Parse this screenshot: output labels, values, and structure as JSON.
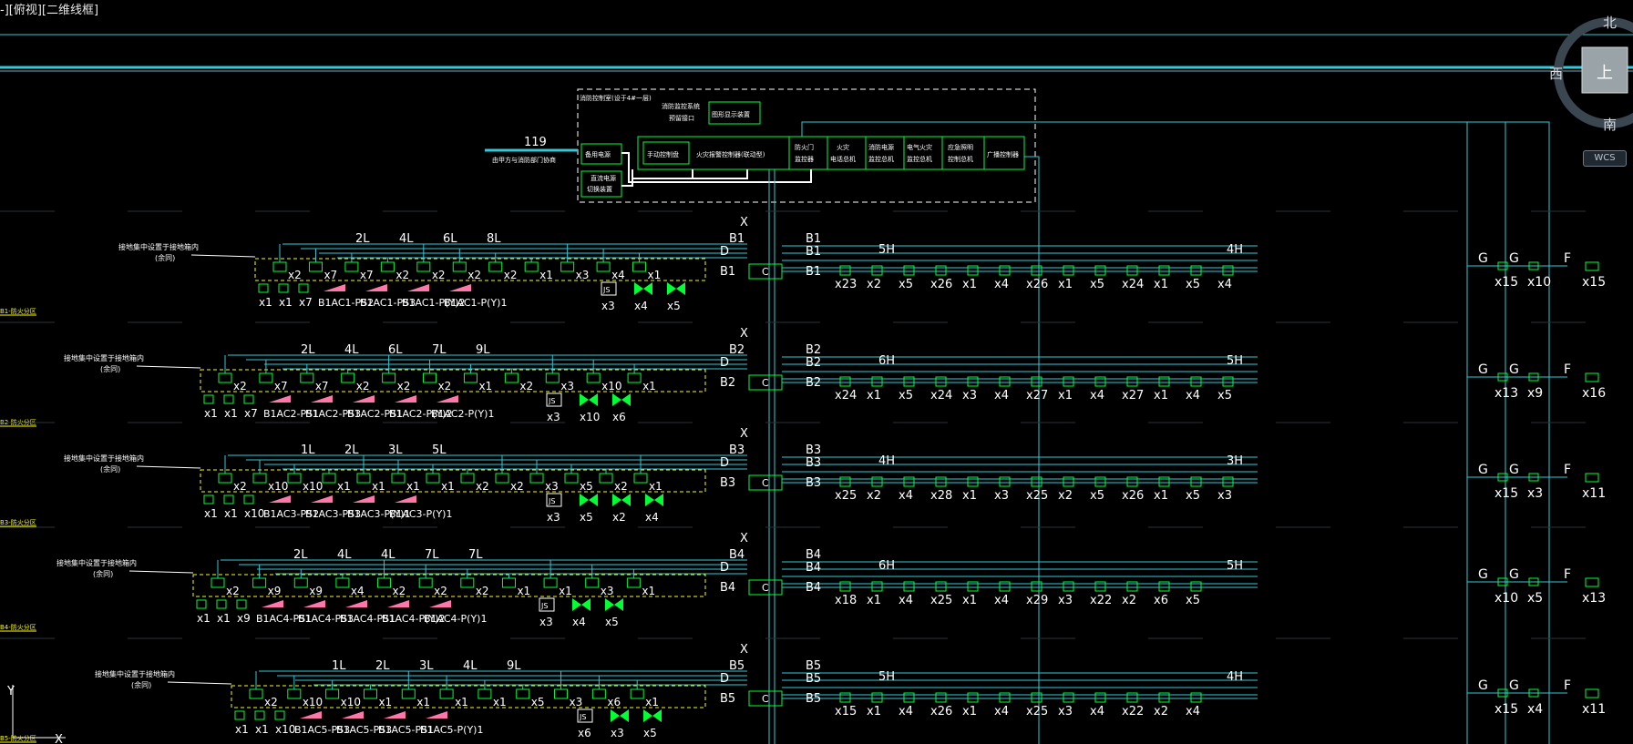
{
  "viewport_label": "-][俯视][二维线框]",
  "viewcube": {
    "north": "北",
    "south": "南",
    "west": "西",
    "top": "上",
    "wcs": "WCS"
  },
  "control_room": {
    "title": "消防控制室(设于4#一层)",
    "exit_note_1": "消防监控系统",
    "exit_note_2": "预留接口",
    "graphic_display": "图形显示装置",
    "backup_power": "备用电源",
    "dc_power_1": "直流电源",
    "dc_power_2": "切换装置",
    "manual_panel": "手动控制盘",
    "fire_controller": "火灾报警控制器(联动型)",
    "fire_door": [
      "防火门",
      "监控器"
    ],
    "fire_phone": [
      "火灾",
      "电话总机"
    ],
    "elec_fire": [
      "消防电源",
      "监控总机"
    ],
    "elec_monitor": [
      "电气火灾",
      "监控总机"
    ],
    "emergency_light": [
      "应急照明",
      "控制总机"
    ],
    "broadcast": "广播控制器"
  },
  "link_119": {
    "number": "119",
    "label": "由甲方与消防部门协商"
  },
  "floor_note": "接地集中设置于接地箱内",
  "floor_note_sub": "(余同)",
  "floors": [
    {
      "id": "B1",
      "side_label": "B1-防火分区",
      "top_loads": [
        "2L",
        "4L",
        "6L",
        "8L"
      ],
      "bottom_counts": [
        "x1",
        "x1",
        "x7",
        "",
        "",
        "",
        "",
        "",
        "",
        "",
        "x3",
        "x4",
        "x5"
      ],
      "panel_labels": [
        "B1AC1-PS2",
        "B1AC1-PS3",
        "B1AC1-P(Y)2",
        "B1AC1-P(Y)1"
      ],
      "row_counts": [
        "x2",
        "x7",
        "x7",
        "x2",
        "x2",
        "x2",
        "x2",
        "x1",
        "x3",
        "x4",
        "x1"
      ],
      "right_top": [
        "B1",
        "B1",
        "5H",
        "4H"
      ],
      "right_counts": [
        "x23",
        "x2",
        "x5",
        "x26",
        "x1",
        "x4",
        "x26",
        "x1",
        "x5",
        "x24",
        "x1",
        "x5",
        "x4"
      ],
      "far": {
        "g1": "x15",
        "g2": "x10",
        "f": "x15"
      }
    },
    {
      "id": "B2",
      "side_label": "B2-防火分区",
      "top_loads": [
        "2L",
        "4L",
        "6L",
        "7L",
        "9L"
      ],
      "bottom_counts": [
        "x1",
        "x1",
        "x7",
        "",
        "",
        "",
        "",
        "",
        "",
        "",
        "x3",
        "x10",
        "x6"
      ],
      "panel_labels": [
        "B1AC2-PS1",
        "B1AC2-PS3",
        "B1AC2-PS1",
        "B1AC2-P(Y)2",
        "B1AC2-P(Y)1"
      ],
      "row_counts": [
        "x2",
        "x7",
        "x7",
        "x2",
        "x2",
        "x2",
        "x1",
        "x2",
        "x3",
        "x10",
        "x1"
      ],
      "right_top": [
        "B2",
        "B2",
        "6H",
        "5H"
      ],
      "right_counts": [
        "x24",
        "x1",
        "x5",
        "x24",
        "x3",
        "x4",
        "x27",
        "x1",
        "x4",
        "x27",
        "x1",
        "x4",
        "x5"
      ],
      "far": {
        "g1": "x13",
        "g2": "x9",
        "f": "x16"
      }
    },
    {
      "id": "B3",
      "side_label": "B3-防火分区",
      "top_loads": [
        "1L",
        "2L",
        "3L",
        "5L"
      ],
      "bottom_counts": [
        "x1",
        "x1",
        "x10",
        "",
        "",
        "",
        "",
        "",
        "",
        "",
        "x3",
        "x5",
        "x2",
        "x4"
      ],
      "panel_labels": [
        "B1AC3-PS2",
        "B1AC3-PS3",
        "B1AC3-P(Y)1",
        "B1AC3-P(Y)1"
      ],
      "row_counts": [
        "x2",
        "x10",
        "x10",
        "x1",
        "x1",
        "x1",
        "x1",
        "x2",
        "x2",
        "x3",
        "x5",
        "x2",
        "x1"
      ],
      "right_top": [
        "B3",
        "B3",
        "4H",
        "3H"
      ],
      "right_counts": [
        "x25",
        "x2",
        "x4",
        "x28",
        "x1",
        "x3",
        "x25",
        "x2",
        "x5",
        "x26",
        "x1",
        "x5",
        "x3"
      ],
      "far": {
        "g1": "x15",
        "g2": "x3",
        "f": "x11"
      }
    },
    {
      "id": "B4",
      "side_label": "B4-防火分区",
      "top_loads": [
        "2L",
        "4L",
        "4L",
        "7L",
        "7L"
      ],
      "bottom_counts": [
        "x1",
        "x1",
        "x9",
        "",
        "",
        "",
        "",
        "",
        "",
        "",
        "x3",
        "x4",
        "x5"
      ],
      "panel_labels": [
        "B1AC4-PS1",
        "B1AC4-PS3",
        "B1AC4-PS1",
        "B1AC4-P(Y)2",
        "B1AC4-P(Y)1"
      ],
      "row_counts": [
        "x2",
        "x9",
        "x9",
        "x4",
        "x2",
        "x2",
        "x2",
        "x1",
        "x1",
        "x3",
        "x1"
      ],
      "right_top": [
        "B4",
        "B4",
        "6H",
        "5H"
      ],
      "right_counts": [
        "x18",
        "x1",
        "x4",
        "x25",
        "x1",
        "x4",
        "x29",
        "x3",
        "x22",
        "x2",
        "x6",
        "x5"
      ],
      "far": {
        "g1": "x10",
        "g2": "x5",
        "f": "x13"
      }
    },
    {
      "id": "B5",
      "side_label": "B5-防火分区",
      "top_loads": [
        "1L",
        "2L",
        "3L",
        "4L",
        "9L"
      ],
      "bottom_counts": [
        "x1",
        "x1",
        "x10",
        "",
        "",
        "",
        "",
        "",
        "",
        "",
        "x6",
        "x3",
        "x5"
      ],
      "panel_labels": [
        "B1AC5-PS3",
        "B1AC5-PS3",
        "B1AC5-PS1",
        "B1AC5-P(Y)1"
      ],
      "row_counts": [
        "x2",
        "x10",
        "x10",
        "x1",
        "x1",
        "x1",
        "x1",
        "x5",
        "x3",
        "x6",
        "x1"
      ],
      "right_top": [
        "B5",
        "B5",
        "5H",
        "4H"
      ],
      "right_counts": [
        "x15",
        "x1",
        "x4",
        "x26",
        "x1",
        "x4",
        "x25",
        "x3",
        "x4",
        "x22",
        "x2",
        "x4"
      ],
      "far": {
        "g1": "x15",
        "g2": "x4",
        "f": "x11"
      }
    }
  ],
  "trunk_labels": {
    "x": "X",
    "d": "D",
    "c": "C",
    "js": "JS",
    "g": "G",
    "f": "F"
  },
  "colors": {
    "cyan": "#35c8d8",
    "green": "#00ff33",
    "yellow": "#ffff00",
    "white": "#ffffff",
    "pink": "#ff77aa",
    "grey": "#6d7a84"
  }
}
